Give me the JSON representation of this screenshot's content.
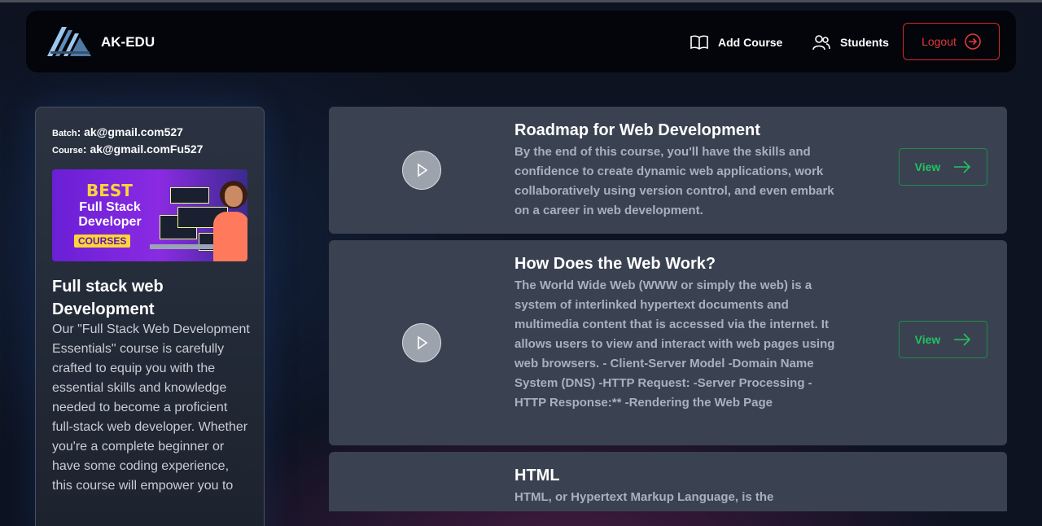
{
  "navbar": {
    "brand": "AK-EDU",
    "add_course": "Add Course",
    "students": "Students",
    "logout": "Logout"
  },
  "sidebar": {
    "batch_label": "Batch",
    "batch_value": ": ak@gmail.com527",
    "course_label": "Course",
    "course_value": ": ak@gmail.comFu527",
    "thumbnail": {
      "best": "BEST",
      "title": "Full Stack Developer",
      "courses": "COURSES"
    },
    "title": "Full stack web Development",
    "description": "Our \"Full Stack Web Development Essentials\" course is carefully crafted to equip you with the essential skills and knowledge needed to become a proficient full-stack web developer. Whether you're a complete beginner or have some coding experience, this course will empower you to"
  },
  "lessons": [
    {
      "title": "Roadmap for Web Development",
      "description": "By the end of this course, you'll have the skills and confidence to create dynamic web applications, work collaboratively using version control, and even embark on a career in web development.",
      "button": "View"
    },
    {
      "title": "How Does the Web Work?",
      "description": "The World Wide Web (WWW or simply the web) is a system of interlinked hypertext documents and multimedia content that is accessed via the internet. It allows users to view and interact with web pages using web browsers. - Client-Server Model -Domain Name System (DNS) -HTTP Request: -Server Processing -HTTP Response:** -Rendering the Web Page",
      "button": "View"
    },
    {
      "title": "HTML",
      "description": "HTML, or Hypertext Markup Language, is the"
    }
  ],
  "colors": {
    "background": "#0d1321",
    "card": "#3a4251",
    "logout": "#d12b2b",
    "view": "#22c35e"
  }
}
